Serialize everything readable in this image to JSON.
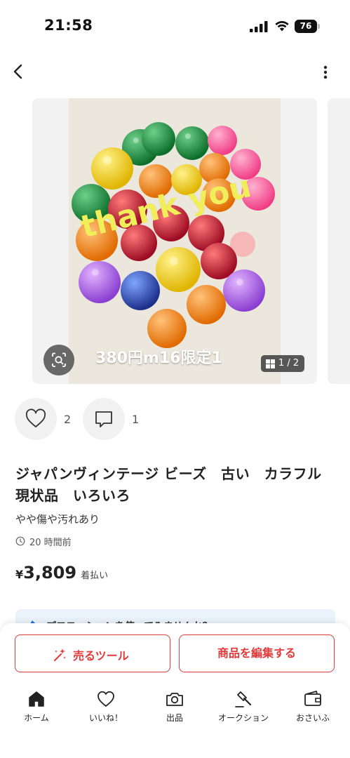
{
  "status_bar": {
    "time": "21:58",
    "battery_level": "76"
  },
  "header": {
    "back_icon": "chevron-left-icon",
    "more_icon": "vertical-ellipsis-icon"
  },
  "gallery": {
    "overlay_text": "thank you",
    "caption": "380円m16限定1",
    "page_indicator": "1 / 2",
    "lens_icon": "image-search-icon"
  },
  "reactions": {
    "like_count": "2",
    "comment_count": "1"
  },
  "item": {
    "title": "ジャパンヴィンテージ ビーズ　古い　カラフル　現状品　いろいろ",
    "condition": "やや傷や汚れあり",
    "posted": "20 時間前",
    "price_currency": "¥",
    "price_amount": "3,809",
    "shipping": "着払い"
  },
  "promo": {
    "text": "プロモーションを使ってみませんか？"
  },
  "actions": {
    "sell_tool_label": "売るツール",
    "edit_label": "商品を編集する"
  },
  "tabs": [
    {
      "label": "ホーム",
      "icon": "home-icon"
    },
    {
      "label": "いいね！",
      "icon": "heart-icon"
    },
    {
      "label": "出品",
      "icon": "camera-icon"
    },
    {
      "label": "オークション",
      "icon": "gavel-icon"
    },
    {
      "label": "おさいふ",
      "icon": "wallet-icon"
    }
  ],
  "colors": {
    "accent": "#e23a3a",
    "text": "#222222",
    "overlay_text": "#f2ee5a"
  }
}
